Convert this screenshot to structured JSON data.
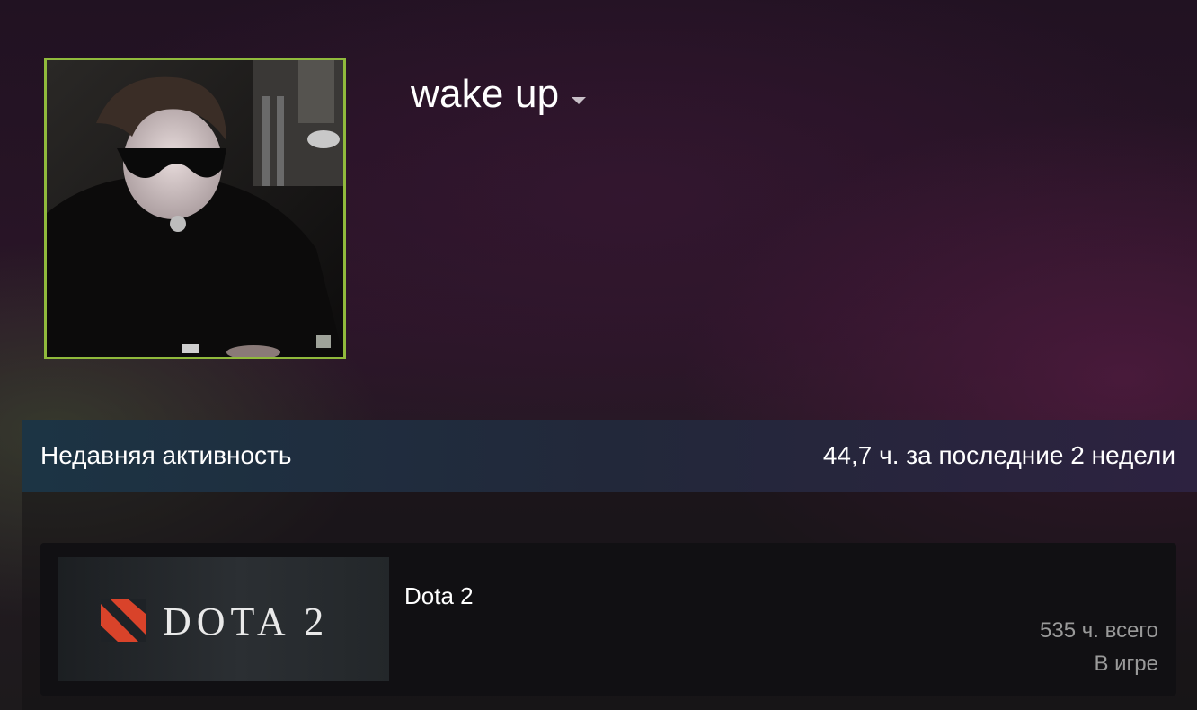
{
  "profile": {
    "persona_name": "wake up",
    "avatar_icon": "avatar-photo",
    "avatar_border_color": "#90ba3c"
  },
  "recent_activity": {
    "title": "Недавняя активность",
    "hours_summary": "44,7 ч. за последние 2 недели",
    "games": [
      {
        "name": "Dota 2",
        "logo_text": "DOTA 2",
        "logo_icon": "dota2-emblem-icon",
        "total_hours": "535 ч. всего",
        "status": "В игре"
      }
    ]
  }
}
